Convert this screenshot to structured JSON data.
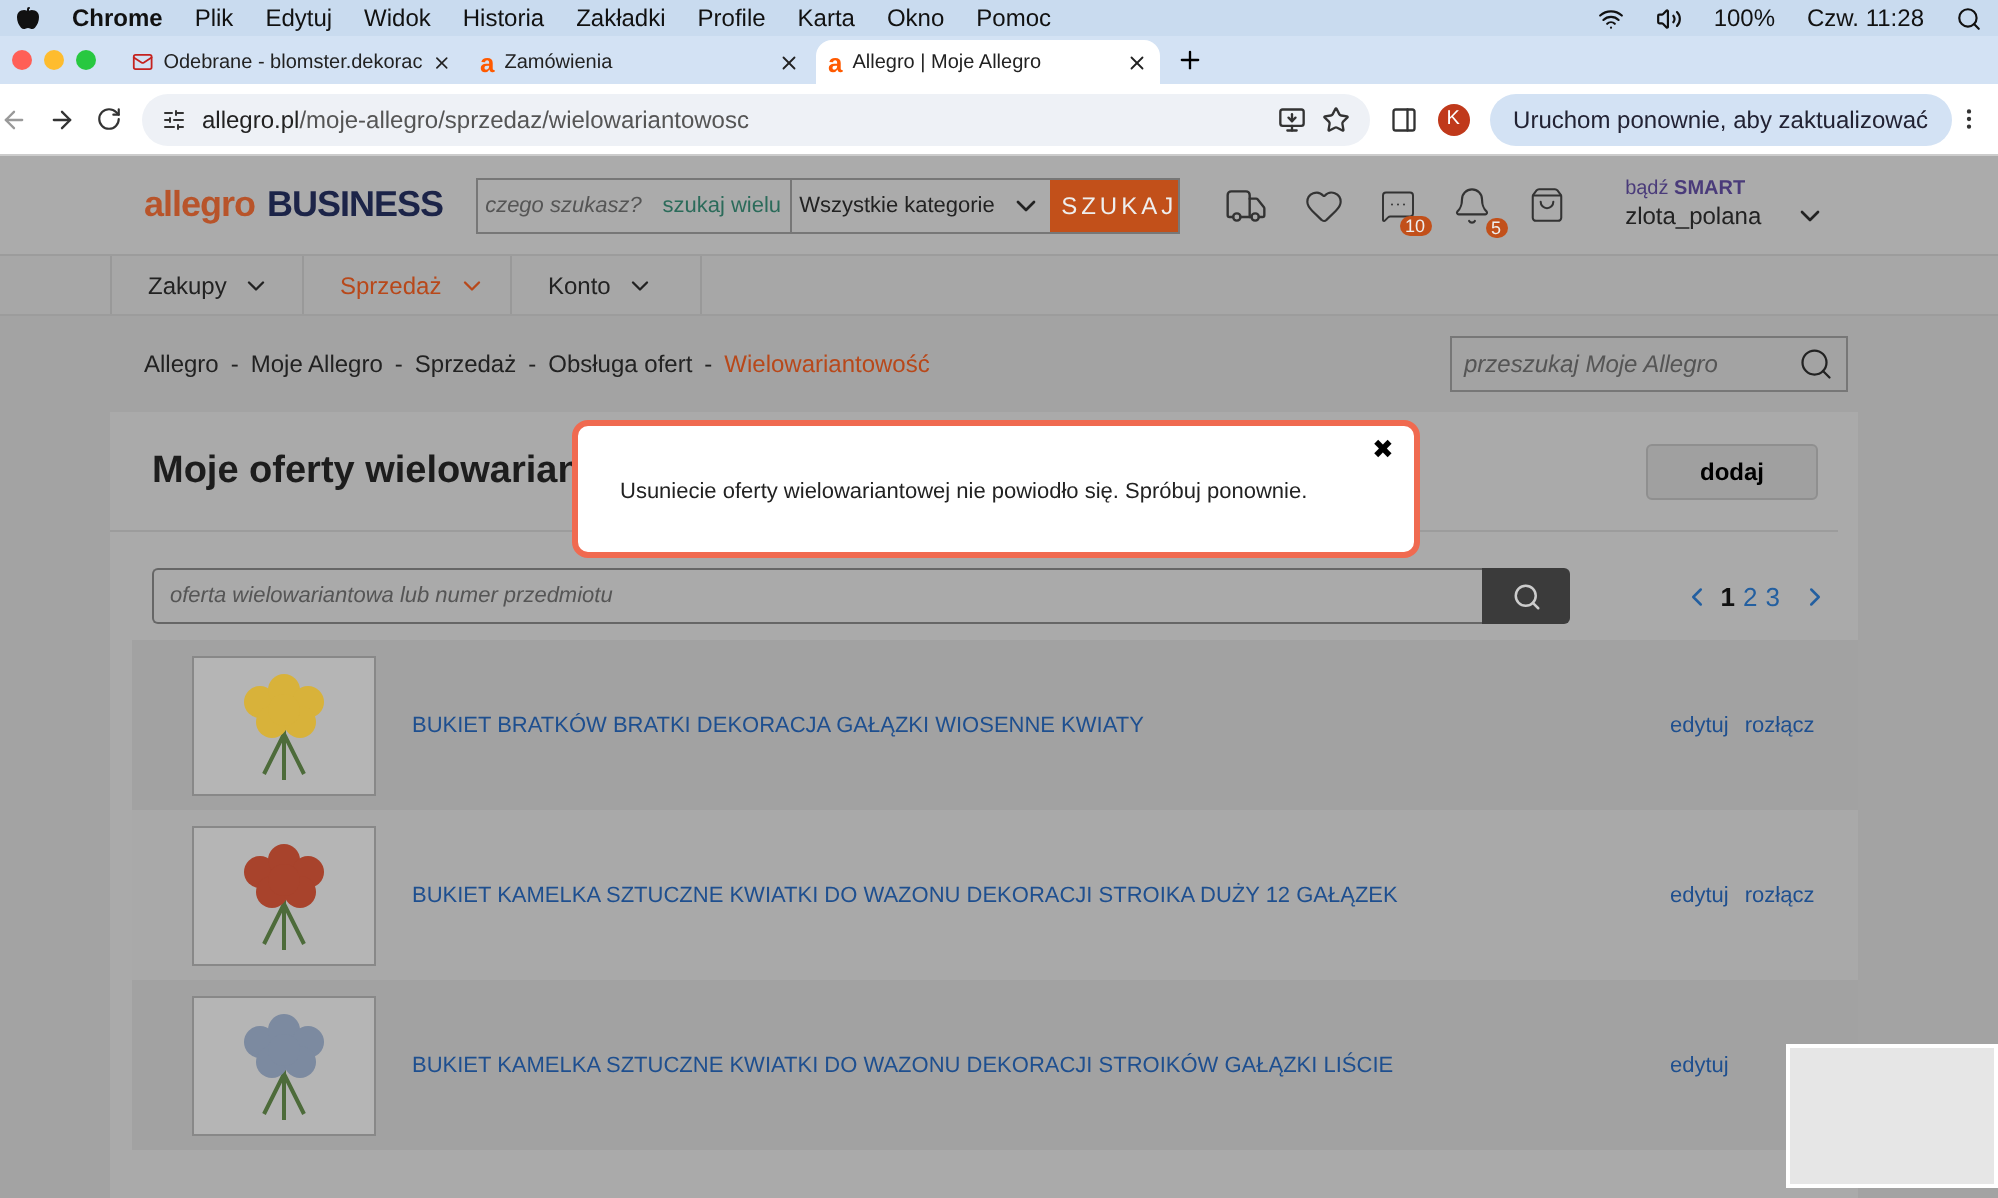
{
  "menubar": {
    "app": "Chrome",
    "items": [
      "Plik",
      "Edytuj",
      "Widok",
      "Historia",
      "Zakładki",
      "Profile",
      "Karta",
      "Okno",
      "Pomoc"
    ],
    "battery": "100%",
    "clock": "Czw. 11:28"
  },
  "tabs": [
    {
      "title": "Odebrane - blomster.dekorac",
      "kind": "mail",
      "selected": false
    },
    {
      "title": "Zamówienia",
      "kind": "site",
      "favicon": "a",
      "selected": false
    },
    {
      "title": "Allegro | Moje Allegro",
      "kind": "site",
      "favicon": "a",
      "selected": true
    }
  ],
  "address": {
    "host": "allegro.pl",
    "path": "/moje-allegro/sprzedaz/wielowariantowosc",
    "profile": "K",
    "update": "Uruchom ponownie, aby zaktualizować"
  },
  "header": {
    "logo": "allegro",
    "logo_suffix": "BUSINESS",
    "search_placeholder": "czego szukasz?",
    "search_many": "szukaj wielu",
    "category": "Wszystkie kategorie",
    "search_button": "SZUKAJ",
    "messages_badge": "10",
    "notifications_badge": "5",
    "smart_prefix": "bądź",
    "smart": "SMART",
    "user": "zlota_polana"
  },
  "nav": [
    {
      "label": "Zakupy",
      "selected": false
    },
    {
      "label": "Sprzedaż",
      "selected": true
    },
    {
      "label": "Konto",
      "selected": false
    }
  ],
  "breadcrumbs": [
    {
      "label": "Allegro",
      "separator": "-"
    },
    {
      "label": "Moje Allegro",
      "separator": "-"
    },
    {
      "label": "Sprzedaż",
      "separator": "-"
    },
    {
      "label": "Obsługa ofert",
      "separator": "-"
    },
    {
      "label": "Wielowariantowość"
    }
  ],
  "side_search": {
    "placeholder": "przeszukaj Moje Allegro"
  },
  "panel": {
    "title": "Moje oferty wielowarian",
    "add_button": "dodaj",
    "search_placeholder": "oferta wielowariantowa lub numer przedmiotu",
    "pages": [
      {
        "label": "1",
        "selected": true
      },
      {
        "label": "2",
        "selected": false
      },
      {
        "label": "3",
        "selected": false
      }
    ]
  },
  "offers": [
    {
      "title": "BUKIET BRATKÓW BRATKI DEKORACJA GAŁĄZKI WIOSENNE KWIATY",
      "color": "#d8b23a",
      "edit": "edytuj",
      "split": "rozłącz"
    },
    {
      "title": "BUKIET KAMELKA SZTUCZNE KWIATKI DO WAZONU DEKORACJI STROIKA DUŻY 12 GAŁĄZEK",
      "color": "#a8432c",
      "edit": "edytuj",
      "split": "rozłącz"
    },
    {
      "title": "BUKIET KAMELKA SZTUCZNE KWIATKI DO WAZONU DEKORACJI STROIKÓW GAŁĄZKI LIŚCIE",
      "color": "#7c8aa0",
      "edit": "edytuj"
    }
  ],
  "modal": {
    "message": "Usuniecie oferty wielowariantowej nie powiodło się. Spróbuj ponownie.",
    "close": "✖"
  }
}
